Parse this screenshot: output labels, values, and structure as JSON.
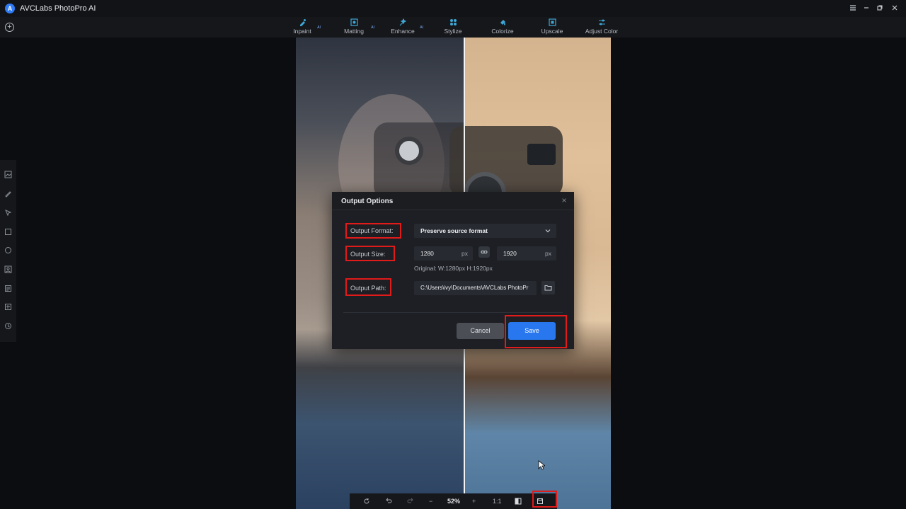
{
  "window": {
    "title": "AVCLabs PhotoPro AI",
    "logo_letter": "A"
  },
  "toolbar": {
    "tools": [
      {
        "label": "Inpaint",
        "badge": "AI"
      },
      {
        "label": "Matting",
        "badge": "AI"
      },
      {
        "label": "Enhance",
        "badge": "AI"
      },
      {
        "label": "Stylize",
        "badge": ""
      },
      {
        "label": "Colorize",
        "badge": ""
      },
      {
        "label": "Upscale",
        "badge": ""
      },
      {
        "label": "Adjust Color",
        "badge": ""
      }
    ]
  },
  "bottom_bar": {
    "zoom": "52%",
    "one_to_one": "1:1",
    "minus": "−",
    "plus": "+"
  },
  "dialog": {
    "title": "Output Options",
    "close_glyph": "×",
    "format_label": "Output Format:",
    "format_value": "Preserve source format",
    "size_label": "Output Size:",
    "width_value": "1280",
    "height_value": "1920",
    "unit": "px",
    "original_text": "Original:  W:1280px  H:1920px",
    "path_label": "Output Path:",
    "path_value": "C:\\Users\\ivy\\Documents\\AVCLabs PhotoPr",
    "cancel_label": "Cancel",
    "save_label": "Save"
  },
  "colors": {
    "accent": "#2877ee",
    "highlight": "#e11a1a",
    "toolbar_icon": "#3fa7d6"
  }
}
